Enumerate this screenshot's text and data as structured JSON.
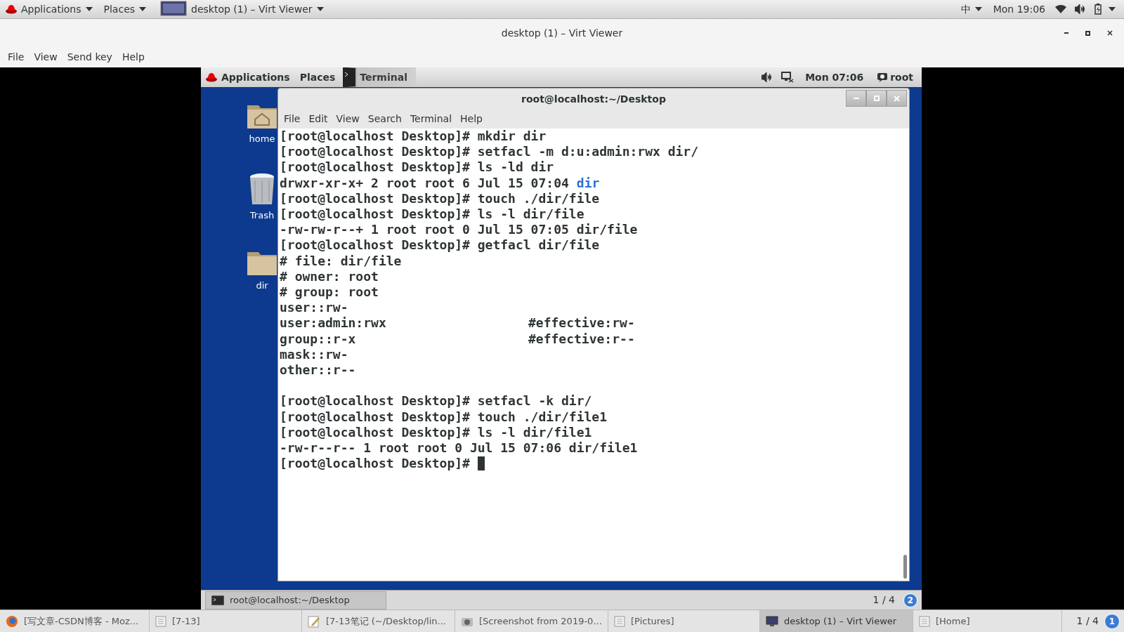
{
  "host_top_bar": {
    "menus": [
      "Applications",
      "Places"
    ],
    "active_window": "desktop (1) – Virt Viewer",
    "input_method": "中",
    "clock": "Mon 19:06"
  },
  "window": {
    "title": "desktop (1) – Virt Viewer",
    "menu": [
      "File",
      "View",
      "Send key",
      "Help"
    ]
  },
  "guest": {
    "top_bar": {
      "menus": [
        "Applications",
        "Places"
      ],
      "active_app": "Terminal",
      "clock": "Mon 07:06",
      "user": "root"
    },
    "desktop_icons": [
      {
        "label": "home",
        "kind": "home"
      },
      {
        "label": "Trash",
        "kind": "trash"
      },
      {
        "label": "dir",
        "kind": "folder"
      }
    ],
    "terminal": {
      "title": "root@localhost:~/Desktop",
      "menu": [
        "File",
        "Edit",
        "View",
        "Search",
        "Terminal",
        "Help"
      ],
      "lines": [
        {
          "segments": [
            {
              "text": "[root@localhost Desktop]# mkdir dir",
              "kind": "plain"
            }
          ]
        },
        {
          "segments": [
            {
              "text": "[root@localhost Desktop]# setfacl -m d:u:admin:rwx dir/",
              "kind": "plain"
            }
          ]
        },
        {
          "segments": [
            {
              "text": "[root@localhost Desktop]# ls -ld dir",
              "kind": "plain"
            }
          ]
        },
        {
          "segments": [
            {
              "text": "drwxr-xr-x+ 2 root root 6 Jul 15 07:04",
              "kind": "plain"
            },
            {
              "text": "dir",
              "kind": "directory"
            }
          ]
        },
        {
          "segments": [
            {
              "text": "[root@localhost Desktop]# touch ./dir/file",
              "kind": "plain"
            }
          ]
        },
        {
          "segments": [
            {
              "text": "[root@localhost Desktop]# ls -l dir/file",
              "kind": "plain"
            }
          ]
        },
        {
          "segments": [
            {
              "text": "-rw-rw-r--+ 1 root root 0 Jul 15 07:05 dir/file",
              "kind": "plain"
            }
          ]
        },
        {
          "segments": [
            {
              "text": "[root@localhost Desktop]# getfacl dir/file",
              "kind": "plain"
            }
          ]
        },
        {
          "segments": [
            {
              "text": "# file: dir/file",
              "kind": "plain"
            }
          ]
        },
        {
          "segments": [
            {
              "text": "# owner: root",
              "kind": "plain"
            }
          ]
        },
        {
          "segments": [
            {
              "text": "# group: root",
              "kind": "plain"
            }
          ]
        },
        {
          "segments": [
            {
              "text": "user::rw-",
              "kind": "plain"
            }
          ]
        },
        {
          "segments": [
            {
              "text": "user:admin:rwx",
              "kind": "plain"
            },
            {
              "text": "#effective:rw-",
              "kind": "comment"
            }
          ]
        },
        {
          "segments": [
            {
              "text": "group::r-x",
              "kind": "plain"
            },
            {
              "text": "#effective:r--",
              "kind": "comment"
            }
          ]
        },
        {
          "segments": [
            {
              "text": "mask::rw-",
              "kind": "plain"
            }
          ]
        },
        {
          "segments": [
            {
              "text": "other::r--",
              "kind": "plain"
            }
          ]
        },
        {
          "segments": [
            {
              "text": "[root@localhost Desktop]# setfacl -k dir/",
              "kind": "plain"
            }
          ],
          "blank_line_before": true
        },
        {
          "segments": [
            {
              "text": "[root@localhost Desktop]# touch ./dir/file1",
              "kind": "plain"
            }
          ]
        },
        {
          "segments": [
            {
              "text": "[root@localhost Desktop]# ls -l dir/file1",
              "kind": "plain"
            }
          ]
        },
        {
          "segments": [
            {
              "text": "-rw-r--r-- 1 root root 0 Jul 15 07:06 dir/file1",
              "kind": "plain"
            }
          ]
        },
        {
          "segments": [
            {
              "text": "[root@localhost Desktop]#",
              "kind": "plain"
            }
          ],
          "cursor": true
        }
      ]
    },
    "taskbar": {
      "items": [
        {
          "label": "root@localhost:~/Desktop"
        }
      ],
      "pager": "1 / 4",
      "notifications": "2"
    }
  },
  "host_taskbar": {
    "items": [
      {
        "label": "[写文章-CSDN博客 - Moz...",
        "kind": "browser",
        "selected": false
      },
      {
        "label": "[7-13]",
        "kind": "window",
        "selected": false
      },
      {
        "label": "[7-13笔记 (~/Desktop/lin...",
        "kind": "editor",
        "selected": false
      },
      {
        "label": "[Screenshot from 2019-0...",
        "kind": "screenshot",
        "selected": false
      },
      {
        "label": "[Pictures]",
        "kind": "window",
        "selected": false
      },
      {
        "label": "desktop (1) – Virt Viewer",
        "kind": "viewer",
        "selected": true
      },
      {
        "label": "[Home]",
        "kind": "window",
        "selected": false
      }
    ],
    "pager": "1 / 4",
    "notifications": "1"
  }
}
